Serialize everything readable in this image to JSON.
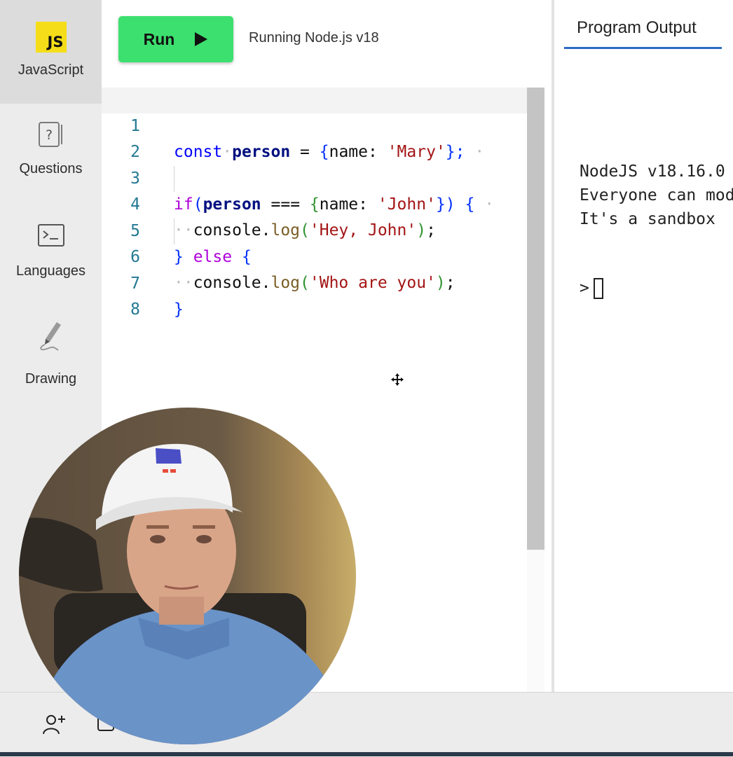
{
  "sidebar": {
    "items": [
      {
        "label": "JavaScript",
        "icon": "js-logo-icon",
        "active": true,
        "badge": "JS"
      },
      {
        "label": "Questions",
        "icon": "question-icon",
        "active": false
      },
      {
        "label": "Languages",
        "icon": "terminal-icon",
        "active": false
      },
      {
        "label": "Drawing",
        "icon": "pencil-icon",
        "active": false
      }
    ]
  },
  "toolbar": {
    "run_label": "Run",
    "status": "Running Node.js v18"
  },
  "editor": {
    "current_line": 1,
    "lines": [
      {
        "number": "1"
      },
      {
        "number": "2"
      },
      {
        "number": "3"
      },
      {
        "number": "4"
      },
      {
        "number": "5"
      },
      {
        "number": "6"
      },
      {
        "number": "7"
      },
      {
        "number": "8"
      }
    ],
    "tokens": {
      "const": "const",
      "person": "person",
      "eq": " = ",
      "open": "{",
      "name_key": "name: ",
      "mary": "'Mary'",
      "close_semi": "};",
      "if": "if",
      "paren_open": "(",
      "strict_eq": " === ",
      "john": "'John'",
      "close_paren": "})",
      "brace_open": " {",
      "console": "console.",
      "log": "log",
      "hey_john": "'Hey, John'",
      "call_end": ");",
      "brace_close": "}",
      "else": " else ",
      "who": "'Who are you'"
    }
  },
  "output": {
    "tab_label": "Program Output",
    "lines": [
      "NodeJS v18.16.0",
      "Everyone can modify",
      "It's a sandbox"
    ],
    "prompt": ">"
  },
  "colors": {
    "run_button": "#3ce06e",
    "js_badge": "#f5de19",
    "tab_underline": "#2d6bc4",
    "keyword": "#0000ff",
    "control_keyword": "#af00db",
    "string": "#a31515",
    "line_number": "#237893"
  }
}
